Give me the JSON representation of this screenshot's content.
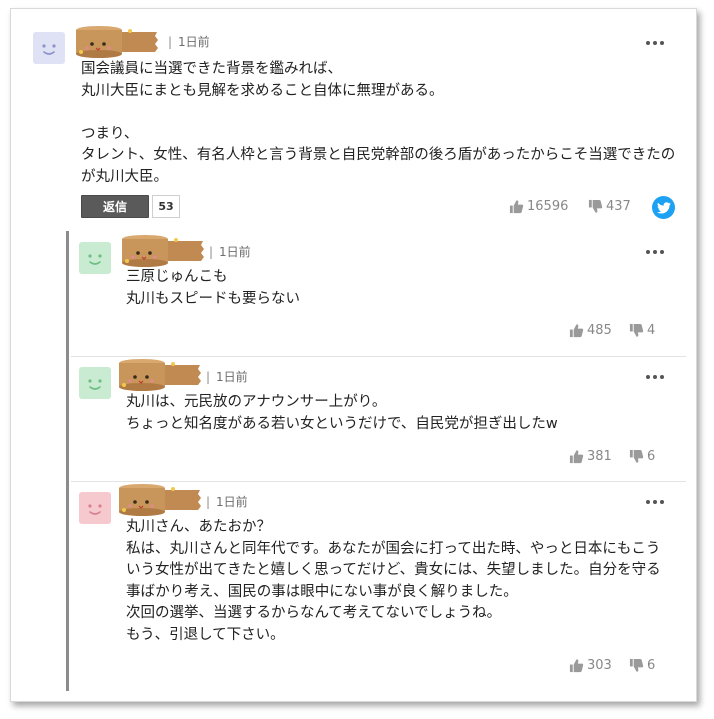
{
  "comment": {
    "time_sep": "|",
    "time": "1日前",
    "body": "国会議員に当選できた背景を鑑みれば、\n丸川大臣にまとも見解を求めること自体に無理がある。\n\nつまり、\nタレント、女性、有名人枠と言う背景と自民党幹部の後ろ盾があったからこそ当選できたのが丸川大臣。",
    "reply_label": "返信",
    "reply_count": "53",
    "likes": "16596",
    "dislikes": "437",
    "avatar_color": "#dfe1f5"
  },
  "replies": [
    {
      "time_sep": "|",
      "time": "1日前",
      "body": "三原じゅんこも\n丸川もスピードも要らない",
      "likes": "485",
      "dislikes": "4",
      "avatar_color": "#c9ebd1"
    },
    {
      "time_sep": "|",
      "time": "1日前",
      "body": "丸川は、元民放のアナウンサー上がり。\nちょっと知名度がある若い女というだけで、自民党が担ぎ出したw",
      "likes": "381",
      "dislikes": "6",
      "avatar_color": "#c9ebd1"
    },
    {
      "time_sep": "|",
      "time": "1日前",
      "body": "丸川さん、あたおか？\n私は、丸川さんと同年代です。あなたが国会に打って出た時、やっと日本にもこういう女性が出てきたと嬉しく思ってだけど、貴女には、失望しました。自分を守る事ばかり考え、国民の事は眼中にない事が良く解りました。\n次回の選挙、当選するからなんて考えてないでしょうね。\nもう、引退して下さい。",
      "likes": "303",
      "dislikes": "6",
      "avatar_color": "#f6c9cf"
    }
  ],
  "icons": {
    "more": "more-dots-icon",
    "like": "thumbs-up-icon",
    "dislike": "thumbs-down-icon",
    "share": "twitter-icon",
    "username_mask": "masking-tape-sticker"
  },
  "colors": {
    "reply_button": "#5a5a5a",
    "twitter": "#1da1f2",
    "thread_line": "#8c8c8c",
    "tape": "#c8955b"
  }
}
